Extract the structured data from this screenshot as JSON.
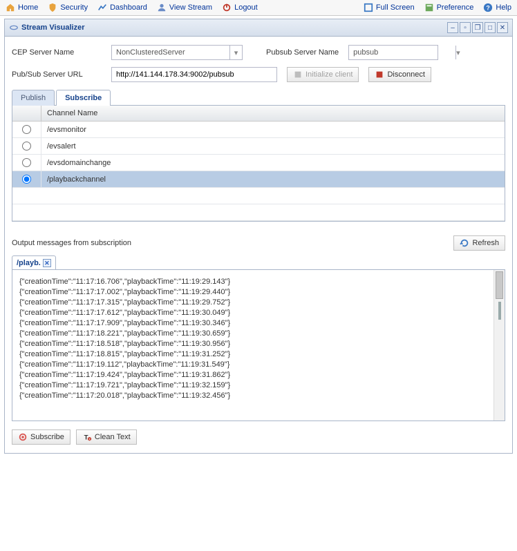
{
  "topnav": {
    "left": [
      {
        "key": "home",
        "label": "Home"
      },
      {
        "key": "security",
        "label": "Security"
      },
      {
        "key": "dashboard",
        "label": "Dashboard"
      },
      {
        "key": "viewstream",
        "label": "View Stream"
      },
      {
        "key": "logout",
        "label": "Logout"
      }
    ],
    "right": [
      {
        "key": "fullscreen",
        "label": "Full Screen"
      },
      {
        "key": "preference",
        "label": "Preference"
      },
      {
        "key": "help",
        "label": "Help"
      }
    ]
  },
  "panel": {
    "title": "Stream Visualizer"
  },
  "form": {
    "cep_label": "CEP Server Name",
    "cep_value": "NonClusteredServer",
    "pubsub_label": "Pubsub Server Name",
    "pubsub_value": "pubsub",
    "url_label": "Pub/Sub Server URL",
    "url_value": "http://141.144.178.34:9002/pubsub",
    "init_btn": "Initialize client",
    "disconnect_btn": "Disconnect"
  },
  "tabs": {
    "publish": "Publish",
    "subscribe": "Subscribe"
  },
  "channels": {
    "header": "Channel Name",
    "rows": [
      {
        "name": "/evsmonitor",
        "selected": false
      },
      {
        "name": "/evsalert",
        "selected": false
      },
      {
        "name": "/evsdomainchange",
        "selected": false
      },
      {
        "name": "/playbackchannel",
        "selected": true
      }
    ]
  },
  "output": {
    "label": "Output messages from subscription",
    "refresh": "Refresh",
    "tab_label": "/playb.",
    "messages": [
      "{\"creationTime\":\"11:17:16.706\",\"playbackTime\":\"11:19:29.143\"}",
      "{\"creationTime\":\"11:17:17.002\",\"playbackTime\":\"11:19:29.440\"}",
      "{\"creationTime\":\"11:17:17.315\",\"playbackTime\":\"11:19:29.752\"}",
      "{\"creationTime\":\"11:17:17.612\",\"playbackTime\":\"11:19:30.049\"}",
      "{\"creationTime\":\"11:17:17.909\",\"playbackTime\":\"11:19:30.346\"}",
      "{\"creationTime\":\"11:17:18.221\",\"playbackTime\":\"11:19:30.659\"}",
      "{\"creationTime\":\"11:17:18.518\",\"playbackTime\":\"11:19:30.956\"}",
      "{\"creationTime\":\"11:17:18.815\",\"playbackTime\":\"11:19:31.252\"}",
      "{\"creationTime\":\"11:17:19.112\",\"playbackTime\":\"11:19:31.549\"}",
      "{\"creationTime\":\"11:17:19.424\",\"playbackTime\":\"11:19:31.862\"}",
      "{\"creationTime\":\"11:17:19.721\",\"playbackTime\":\"11:19:32.159\"}",
      "{\"creationTime\":\"11:17:20.018\",\"playbackTime\":\"11:19:32.456\"}"
    ]
  },
  "actions": {
    "subscribe": "Subscribe",
    "clean": "Clean Text"
  }
}
